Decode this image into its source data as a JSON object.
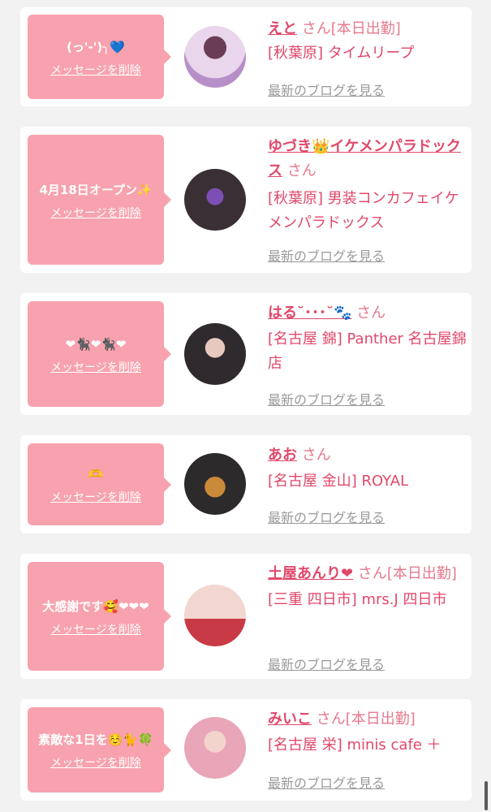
{
  "cards": [
    {
      "message": "(っ'-')╮💙",
      "delete_label": "メッセージを削除",
      "name": "えと",
      "suffix": "さん[本日出勤]",
      "shop": "[秋葉原] タイムリープ",
      "blog_label": "最新のブログを見る",
      "avatar_color": "#d9b4e3"
    },
    {
      "message": "4月18日オープン✨",
      "delete_label": "メッセージを削除",
      "name": "ゆづき👑イケメンパラドックス",
      "suffix": "さん",
      "shop": "[秋葉原] 男装コンカフェイケメンパラドックス",
      "blog_label": "最新のブログを見る",
      "avatar_color": "#3a2f35"
    },
    {
      "message": "❤🐈‍⬛❤🐈‍⬛❤",
      "delete_label": "メッセージを削除",
      "name": "はる˘･･･˘🐾",
      "suffix": "さん",
      "shop": "[名古屋 錦] Panther 名古屋錦店",
      "blog_label": "最新のブログを見る",
      "avatar_color": "#4a4448"
    },
    {
      "message": "🫶",
      "delete_label": "メッセージを削除",
      "name": "あお",
      "suffix": "さん",
      "shop": "[名古屋 金山] ROYAL",
      "blog_label": "最新のブログを見る",
      "avatar_color": "#2d2a2c"
    },
    {
      "message": "大感謝です🥰❤❤❤",
      "delete_label": "メッセージを削除",
      "name": "土屋あんり❤",
      "suffix": "さん[本日出勤]",
      "shop": "[三重 四日市] mrs.J 四日市",
      "blog_label": "最新のブログを見る",
      "avatar_color": "#c83a45"
    },
    {
      "message": "素敵な1日を☺️🐈🍀",
      "delete_label": "メッセージを削除",
      "name": "みいこ",
      "suffix": "さん[本日出勤]",
      "shop": "[名古屋 栄] minis cafe ＋",
      "blog_label": "最新のブログを見る",
      "avatar_color": "#e8a6b8"
    }
  ]
}
